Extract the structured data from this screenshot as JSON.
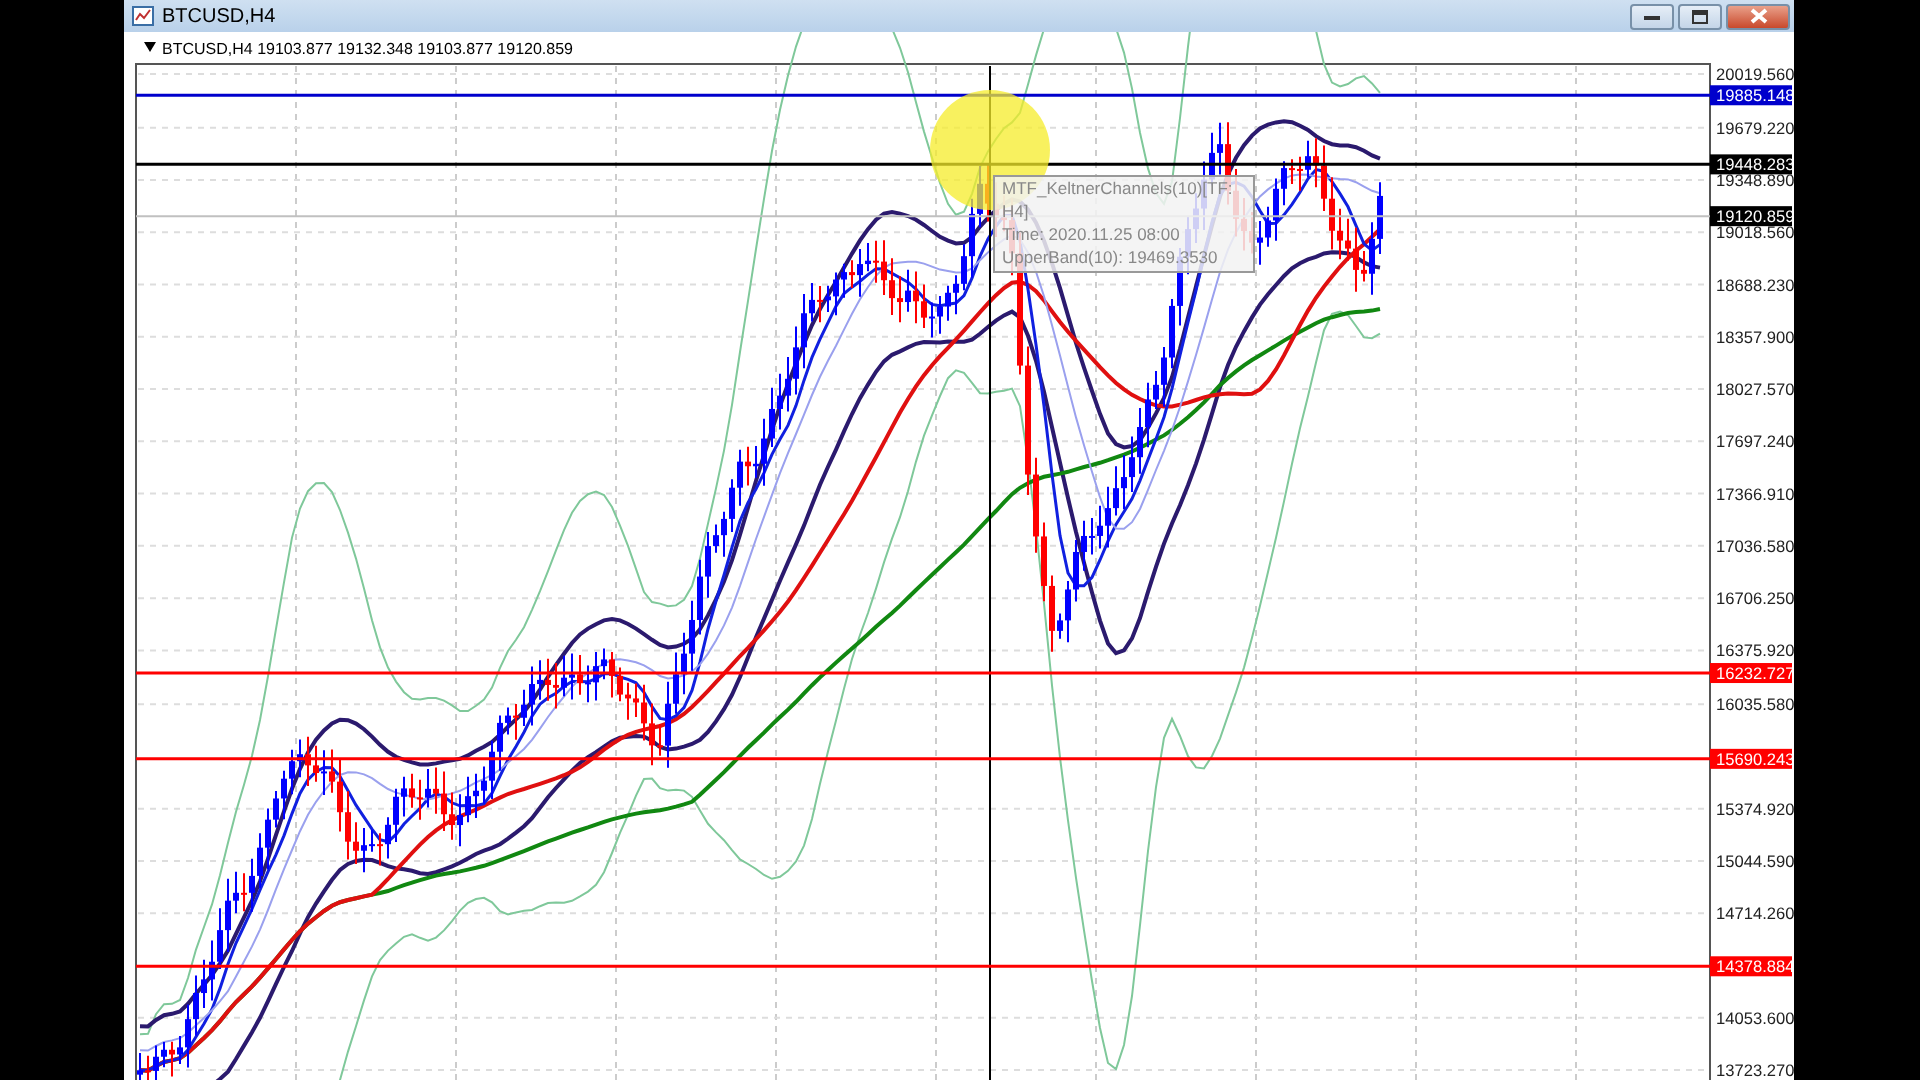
{
  "window": {
    "title": "BTCUSD,H4"
  },
  "legend": {
    "text": "BTCUSD,H4  19103.877 19132.348 19103.877 19120.859"
  },
  "price_axis": [
    "20019.560",
    "19679.220",
    "19348.890",
    "19018.560",
    "18688.230",
    "18357.900",
    "18027.570",
    "17697.240",
    "17366.910",
    "17036.580",
    "16706.250",
    "16375.920",
    "16035.580",
    "15374.920",
    "15044.590",
    "14714.260",
    "14053.600",
    "13723.270"
  ],
  "price_tags": [
    {
      "label": "19885.148",
      "kind": "level",
      "color": "#0000cc"
    },
    {
      "label": "19448.283",
      "kind": "level",
      "color": "#000000"
    },
    {
      "label": "19120.859",
      "kind": "bid",
      "color": "#000000"
    },
    {
      "label": "16232.727",
      "kind": "level",
      "color": "#ff0000"
    },
    {
      "label": "15690.243",
      "kind": "level",
      "color": "#ff0000"
    },
    {
      "label": "14378.884",
      "kind": "level",
      "color": "#ff0000"
    }
  ],
  "tooltip": {
    "lines": [
      "MTF_KeltnerChannels(10)[TF:",
      "H4]",
      "Time: 2020.11.25 08:00",
      "UpperBand(10): 19469.3530"
    ]
  }
}
